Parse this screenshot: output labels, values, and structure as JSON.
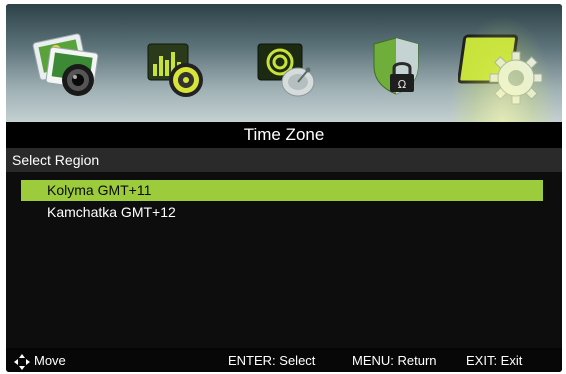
{
  "menu": {
    "icons": [
      {
        "name": "picture-icon",
        "selected": false
      },
      {
        "name": "sound-icon",
        "selected": false
      },
      {
        "name": "channel-icon",
        "selected": false
      },
      {
        "name": "lock-icon",
        "selected": false
      },
      {
        "name": "setup-gear-icon",
        "selected": true
      }
    ]
  },
  "screen": {
    "title": "Time Zone",
    "section_label": "Select Region",
    "regions": [
      {
        "label": "Kolyma GMT+11",
        "selected": true
      },
      {
        "label": "Kamchatka GMT+12",
        "selected": false
      }
    ]
  },
  "footer": {
    "move_icon": "dpad-arrows-icon",
    "move": "Move",
    "enter": "ENTER: Select",
    "menu": "MENU: Return",
    "exit": "EXIT: Exit"
  },
  "colors": {
    "highlight": "#9ccc3c",
    "background": "#050505",
    "row_label_bg": "#2a2a2a"
  }
}
